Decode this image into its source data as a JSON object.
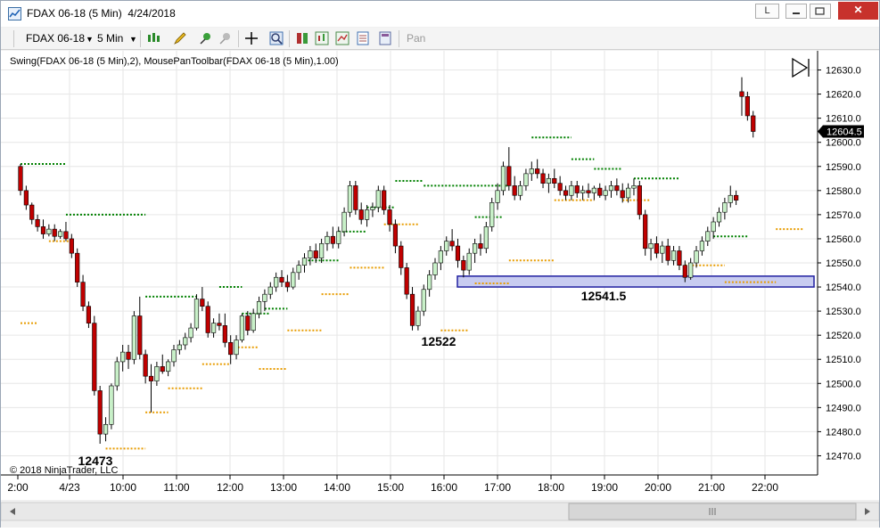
{
  "window": {
    "title": "FDAX 06-18 (5 Min)  4/24/2018",
    "buttons": {
      "minimize": "L",
      "restore": "▭",
      "maximize": "▢",
      "close": "✕"
    }
  },
  "toolbar": {
    "instrument": "FDAX 06-18",
    "interval": "5 Min",
    "pan_label": "Pan"
  },
  "indicator_label": "Swing(FDAX 06-18 (5 Min),2), MousePanToolbar(FDAX 06-18 (5 Min),1.00)",
  "copyright": "© 2018 NinjaTrader, LLC",
  "colors": {
    "up_candle": "#c8f0c8",
    "down_candle": "#c00000",
    "swing_high": "#008000",
    "swing_low": "#e89c00",
    "zone_fill": "#c8ccf0",
    "zone_border": "#2020a0",
    "price_tag": "#000000"
  },
  "chart_data": {
    "type": "candlestick",
    "y_range": [
      12465,
      12635
    ],
    "y_ticks": [
      "12630.0",
      "12620.0",
      "12610.0",
      "12600.0",
      "12590.0",
      "12580.0",
      "12570.0",
      "12560.0",
      "12550.0",
      "12540.0",
      "12530.0",
      "12520.0",
      "12510.0",
      "12500.0",
      "12490.0",
      "12480.0",
      "12470.0"
    ],
    "y_tick_values": [
      12630,
      12620,
      12610,
      12600,
      12590,
      12580,
      12570,
      12560,
      12550,
      12540,
      12530,
      12520,
      12510,
      12500,
      12490,
      12480,
      12470
    ],
    "current_price": "12604.5",
    "current_price_value": 12604.5,
    "x_labels": [
      "2:00",
      "4/23",
      "10:00",
      "11:00",
      "12:00",
      "13:00",
      "14:00",
      "15:00",
      "16:00",
      "17:00",
      "18:00",
      "19:00",
      "20:00",
      "21:00",
      "22:00"
    ],
    "annotations": [
      {
        "text": "12473",
        "price": 12473
      },
      {
        "text": "12522",
        "price": 12522
      },
      {
        "text": "12541.5",
        "price": 12541.5
      }
    ],
    "zone": {
      "low": 12540,
      "high": 12544.5,
      "label": "12541.5"
    },
    "candles": [
      [
        12590,
        12591,
        12578,
        12580
      ],
      [
        12580,
        12582,
        12572,
        12574
      ],
      [
        12574,
        12575,
        12566,
        12568
      ],
      [
        12568,
        12570,
        12563,
        12565
      ],
      [
        12565,
        12568,
        12560,
        12562
      ],
      [
        12562,
        12566,
        12561,
        12564
      ],
      [
        12564,
        12566,
        12559,
        12561
      ],
      [
        12561,
        12564,
        12560,
        12563
      ],
      [
        12563,
        12567,
        12559,
        12560
      ],
      [
        12560,
        12562,
        12552,
        12554
      ],
      [
        12554,
        12556,
        12540,
        12542
      ],
      [
        12542,
        12545,
        12530,
        12532
      ],
      [
        12532,
        12534,
        12523,
        12525
      ],
      [
        12525,
        12528,
        12495,
        12497
      ],
      [
        12497,
        12499,
        12475,
        12479
      ],
      [
        12479,
        12486,
        12476,
        12483
      ],
      [
        12483,
        12500,
        12481,
        12499
      ],
      [
        12499,
        12511,
        12497,
        12509
      ],
      [
        12509,
        12516,
        12505,
        12513
      ],
      [
        12513,
        12516,
        12506,
        12510
      ],
      [
        12510,
        12530,
        12508,
        12528
      ],
      [
        12528,
        12536,
        12510,
        12512
      ],
      [
        12512,
        12514,
        12500,
        12503
      ],
      [
        12503,
        12508,
        12488,
        12501
      ],
      [
        12501,
        12509,
        12499,
        12507
      ],
      [
        12507,
        12512,
        12504,
        12505
      ],
      [
        12505,
        12510,
        12503,
        12509
      ],
      [
        12509,
        12516,
        12507,
        12514
      ],
      [
        12514,
        12518,
        12512,
        12516
      ],
      [
        12516,
        12521,
        12514,
        12519
      ],
      [
        12519,
        12525,
        12517,
        12523
      ],
      [
        12523,
        12537,
        12522,
        12535
      ],
      [
        12535,
        12540,
        12530,
        12532
      ],
      [
        12532,
        12534,
        12519,
        12521
      ],
      [
        12521,
        12527,
        12519,
        12525
      ],
      [
        12525,
        12529,
        12522,
        12524
      ],
      [
        12524,
        12529,
        12515,
        12517
      ],
      [
        12517,
        12520,
        12508,
        12512
      ],
      [
        12512,
        12520,
        12510,
        12518
      ],
      [
        12518,
        12529,
        12517,
        12528
      ],
      [
        12528,
        12530,
        12520,
        12522
      ],
      [
        12522,
        12531,
        12521,
        12529
      ],
      [
        12529,
        12536,
        12527,
        12534
      ],
      [
        12534,
        12539,
        12530,
        12537
      ],
      [
        12537,
        12542,
        12535,
        12540
      ],
      [
        12540,
        12546,
        12538,
        12544
      ],
      [
        12544,
        12547,
        12540,
        12542
      ],
      [
        12542,
        12545,
        12538,
        12540
      ],
      [
        12540,
        12548,
        12539,
        12546
      ],
      [
        12546,
        12551,
        12543,
        12549
      ],
      [
        12549,
        12554,
        12546,
        12552
      ],
      [
        12552,
        12557,
        12549,
        12555
      ],
      [
        12555,
        12558,
        12550,
        12552
      ],
      [
        12552,
        12560,
        12550,
        12558
      ],
      [
        12558,
        12563,
        12555,
        12561
      ],
      [
        12561,
        12565,
        12556,
        12558
      ],
      [
        12558,
        12565,
        12556,
        12563
      ],
      [
        12563,
        12573,
        12561,
        12571
      ],
      [
        12571,
        12584,
        12569,
        12582
      ],
      [
        12582,
        12584,
        12570,
        12572
      ],
      [
        12572,
        12575,
        12566,
        12568
      ],
      [
        12568,
        12574,
        12565,
        12572
      ],
      [
        12572,
        12575,
        12569,
        12573
      ],
      [
        12573,
        12582,
        12571,
        12580
      ],
      [
        12580,
        12582,
        12570,
        12572
      ],
      [
        12572,
        12574,
        12563,
        12566
      ],
      [
        12566,
        12568,
        12554,
        12557
      ],
      [
        12557,
        12559,
        12545,
        12548
      ],
      [
        12548,
        12550,
        12535,
        12537
      ],
      [
        12537,
        12540,
        12522,
        12524
      ],
      [
        12524,
        12532,
        12522,
        12530
      ],
      [
        12530,
        12541,
        12528,
        12539
      ],
      [
        12539,
        12547,
        12536,
        12545
      ],
      [
        12545,
        12552,
        12543,
        12550
      ],
      [
        12550,
        12557,
        12547,
        12555
      ],
      [
        12555,
        12561,
        12553,
        12559
      ],
      [
        12559,
        12564,
        12555,
        12557
      ],
      [
        12557,
        12560,
        12548,
        12551
      ],
      [
        12551,
        12553,
        12544,
        12547
      ],
      [
        12547,
        12556,
        12545,
        12554
      ],
      [
        12554,
        12560,
        12550,
        12558
      ],
      [
        12558,
        12562,
        12553,
        12556
      ],
      [
        12556,
        12567,
        12554,
        12565
      ],
      [
        12565,
        12577,
        12563,
        12575
      ],
      [
        12575,
        12583,
        12572,
        12580
      ],
      [
        12580,
        12592,
        12578,
        12590
      ],
      [
        12590,
        12598,
        12580,
        12582
      ],
      [
        12582,
        12586,
        12576,
        12578
      ],
      [
        12578,
        12584,
        12576,
        12582
      ],
      [
        12582,
        12589,
        12580,
        12587
      ],
      [
        12587,
        12592,
        12584,
        12589
      ],
      [
        12589,
        12593,
        12585,
        12587
      ],
      [
        12587,
        12589,
        12581,
        12583
      ],
      [
        12583,
        12587,
        12579,
        12585
      ],
      [
        12585,
        12589,
        12581,
        12583
      ],
      [
        12583,
        12586,
        12578,
        12580
      ],
      [
        12580,
        12582,
        12576,
        12578
      ],
      [
        12578,
        12584,
        12576,
        12582
      ],
      [
        12582,
        12584,
        12577,
        12579
      ],
      [
        12579,
        12582,
        12576,
        12580
      ],
      [
        12580,
        12583,
        12577,
        12579
      ],
      [
        12579,
        12582,
        12576,
        12581
      ],
      [
        12581,
        12583,
        12577,
        12578
      ],
      [
        12578,
        12582,
        12576,
        12580
      ],
      [
        12580,
        12584,
        12577,
        12582
      ],
      [
        12582,
        12585,
        12578,
        12580
      ],
      [
        12580,
        12583,
        12575,
        12577
      ],
      [
        12577,
        12583,
        12575,
        12581
      ],
      [
        12581,
        12585,
        12578,
        12582
      ],
      [
        12582,
        12584,
        12568,
        12570
      ],
      [
        12570,
        12572,
        12553,
        12556
      ],
      [
        12556,
        12560,
        12551,
        12558
      ],
      [
        12558,
        12561,
        12552,
        12554
      ],
      [
        12554,
        12559,
        12550,
        12557
      ],
      [
        12557,
        12560,
        12549,
        12551
      ],
      [
        12551,
        12557,
        12549,
        12555
      ],
      [
        12555,
        12557,
        12547,
        12549
      ],
      [
        12549,
        12551,
        12542,
        12544
      ],
      [
        12544,
        12552,
        12543,
        12550
      ],
      [
        12550,
        12557,
        12548,
        12555
      ],
      [
        12555,
        12561,
        12553,
        12559
      ],
      [
        12559,
        12565,
        12557,
        12563
      ],
      [
        12563,
        12569,
        12560,
        12567
      ],
      [
        12567,
        12573,
        12565,
        12571
      ],
      [
        12571,
        12577,
        12568,
        12575
      ],
      [
        12575,
        12582,
        12573,
        12578
      ],
      [
        12578,
        12580,
        12574,
        12576
      ],
      [
        12621,
        12627,
        12611,
        12619
      ],
      [
        12619,
        12621,
        12609,
        12611
      ],
      [
        12611,
        12613,
        12602,
        12604.5
      ]
    ],
    "swing_highs": [
      {
        "price": 12591,
        "from": 0,
        "to": 8
      },
      {
        "price": 12570,
        "from": 8,
        "to": 22
      },
      {
        "price": 12536,
        "from": 22,
        "to": 31
      },
      {
        "price": 12540,
        "from": 35,
        "to": 39
      },
      {
        "price": 12529,
        "from": 39,
        "to": 44
      },
      {
        "price": 12531,
        "from": 43,
        "to": 47
      },
      {
        "price": 12551,
        "from": 50,
        "to": 56
      },
      {
        "price": 12563,
        "from": 56,
        "to": 61
      },
      {
        "price": 12573,
        "from": 61,
        "to": 66
      },
      {
        "price": 12584,
        "from": 66,
        "to": 71
      },
      {
        "price": 12582,
        "from": 71,
        "to": 86
      },
      {
        "price": 12569,
        "from": 80,
        "to": 85
      },
      {
        "price": 12602,
        "from": 90,
        "to": 97
      },
      {
        "price": 12593,
        "from": 97,
        "to": 101
      },
      {
        "price": 12589,
        "from": 101,
        "to": 106
      },
      {
        "price": 12585,
        "from": 108,
        "to": 116
      },
      {
        "price": 12561,
        "from": 122,
        "to": 128
      }
    ],
    "swing_lows": [
      {
        "price": 12525,
        "from": 0,
        "to": 3
      },
      {
        "price": 12559,
        "from": 5,
        "to": 9
      },
      {
        "price": 12473,
        "from": 15,
        "to": 22
      },
      {
        "price": 12488,
        "from": 22,
        "to": 26
      },
      {
        "price": 12498,
        "from": 26,
        "to": 32
      },
      {
        "price": 12508,
        "from": 32,
        "to": 37
      },
      {
        "price": 12515,
        "from": 37,
        "to": 42
      },
      {
        "price": 12506,
        "from": 42,
        "to": 47
      },
      {
        "price": 12522,
        "from": 47,
        "to": 53
      },
      {
        "price": 12537,
        "from": 53,
        "to": 58
      },
      {
        "price": 12548,
        "from": 58,
        "to": 64
      },
      {
        "price": 12566,
        "from": 64,
        "to": 70
      },
      {
        "price": 12522,
        "from": 74,
        "to": 79
      },
      {
        "price": 12541.5,
        "from": 80,
        "to": 86
      },
      {
        "price": 12551,
        "from": 86,
        "to": 94
      },
      {
        "price": 12576,
        "from": 94,
        "to": 101
      },
      {
        "price": 12576,
        "from": 106,
        "to": 111
      },
      {
        "price": 12549,
        "from": 117,
        "to": 124
      },
      {
        "price": 12542,
        "from": 124,
        "to": 133
      },
      {
        "price": 12564,
        "from": 133,
        "to": 138
      }
    ]
  }
}
